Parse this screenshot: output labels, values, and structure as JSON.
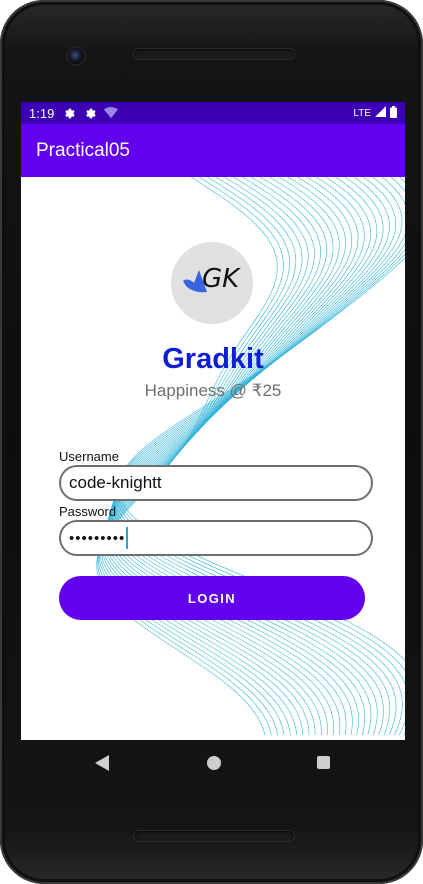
{
  "status": {
    "time": "1:19",
    "network": "LTE",
    "icons": [
      "gear-icon",
      "gear-icon",
      "wifi-icon",
      "signal-icon",
      "battery-icon"
    ]
  },
  "app": {
    "title": "Practical05",
    "colors": {
      "primary": "#6200ee",
      "status_bar": "#3c00b5",
      "brand": "#0f1fd4",
      "waves": "#2fb3d8"
    }
  },
  "logo": {
    "text": "GK"
  },
  "brand": {
    "name": "Gradkit",
    "tagline": "Happiness @ ₹25"
  },
  "form": {
    "username_label": "Username",
    "username_value": "code-knightt",
    "password_label": "Password",
    "password_value": "•••••••••",
    "login_label": "LOGIN"
  },
  "nav": {
    "icons": [
      "back-icon",
      "home-icon",
      "recents-icon"
    ]
  }
}
